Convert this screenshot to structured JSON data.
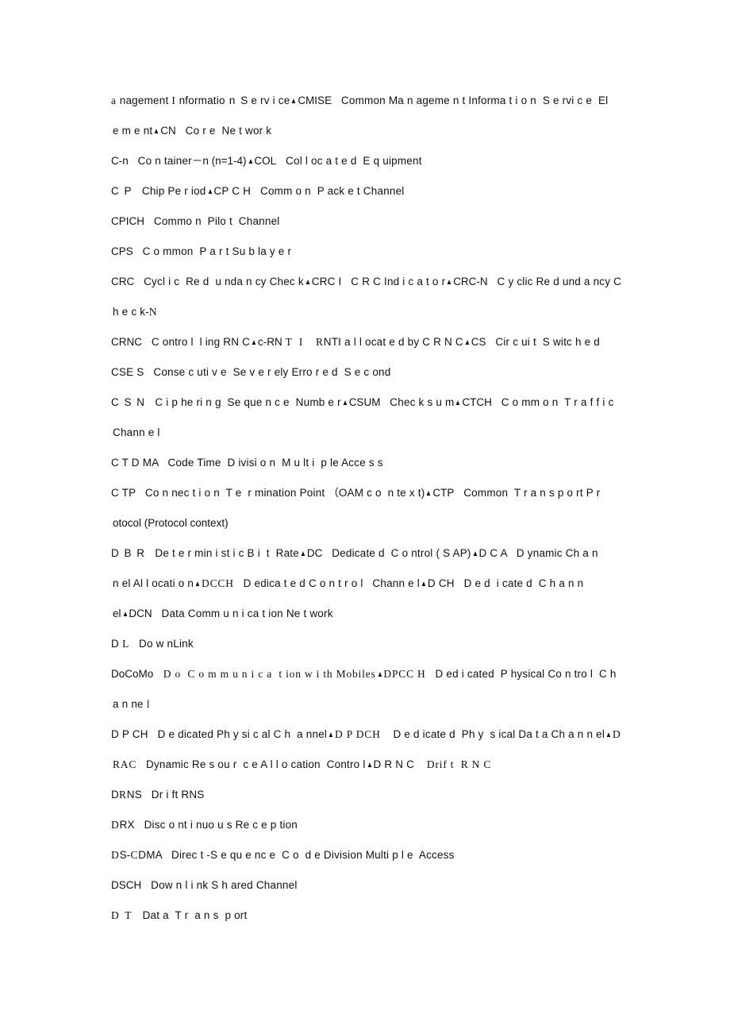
{
  "document": {
    "kind": "abbreviations-glossary",
    "separator_glyph": "▲",
    "separator_name": "triangle-separator",
    "page_background": "#ffffff",
    "text_color": "#111111",
    "lines": [
      {
        "id": "line-1",
        "continuation": false,
        "runs": [
          {
            "text": "a",
            "style": "serif"
          },
          {
            "text": " nagement ",
            "style": "normal"
          },
          {
            "text": "I",
            "style": "serif"
          },
          {
            "text": " nformatio",
            "style": "normal"
          },
          {
            "text": " n ",
            "style": "wide"
          },
          {
            "text": "S e rv i ce",
            "style": "normal"
          },
          {
            "text": "▲",
            "style": "sep"
          },
          {
            "text": "CMISE",
            "style": "tight"
          },
          {
            "text": "   Common Ma n ageme n t Informa t i o n  S e rvi c e  El",
            "style": "normal"
          }
        ],
        "plain": "a nagement I nformatio n S e rv i ce▲CMISE   Common Ma n ageme n t Informa t i o n  S e rvi c e  El"
      },
      {
        "id": "line-2",
        "continuation": true,
        "runs": [
          {
            "text": "e m e nt",
            "style": "normal"
          },
          {
            "text": "▲",
            "style": "sep"
          },
          {
            "text": "CN",
            "style": "tight"
          },
          {
            "text": "   Co r e  Ne t wor k",
            "style": "normal"
          }
        ],
        "plain": "e m e nt▲CN   Co r e  Ne t wor k"
      },
      {
        "id": "line-3",
        "continuation": false,
        "runs": [
          {
            "text": "C-n",
            "style": "tight"
          },
          {
            "text": "   Co n tainer",
            "style": "normal"
          },
          {
            "text": "－",
            "style": "tight"
          },
          {
            "text": "n (n=1-4)",
            "style": "tight"
          },
          {
            "text": "▲",
            "style": "sep"
          },
          {
            "text": "COL",
            "style": "tight"
          },
          {
            "text": "   Col l oc a t e d  E q uipment",
            "style": "normal"
          }
        ],
        "plain": "C-n   Co n tainer－n (n=1-4)▲COL   Col l oc a t e d E q uipment"
      },
      {
        "id": "line-4",
        "continuation": false,
        "runs": [
          {
            "text": "C P",
            "style": "wide"
          },
          {
            "text": "   Chip Pe r iod",
            "style": "normal"
          },
          {
            "text": "▲",
            "style": "sep"
          },
          {
            "text": "CP C H",
            "style": "normal"
          },
          {
            "text": "   Comm o n  P ack e t Channel",
            "style": "normal"
          }
        ],
        "plain": "C P   Chip Pe r iod▲CP C H   Comm o n  P ack e t Channel"
      },
      {
        "id": "line-5",
        "continuation": false,
        "runs": [
          {
            "text": "CPICH",
            "style": "tight"
          },
          {
            "text": "   Commo n  Pilo t  Channel",
            "style": "normal"
          }
        ],
        "plain": "CPICH   Commo n Pilo t  Channel"
      },
      {
        "id": "line-6",
        "continuation": false,
        "runs": [
          {
            "text": "CPS",
            "style": "tight"
          },
          {
            "text": "   C o mmon  P a r t Su b la y e r",
            "style": "normal"
          }
        ],
        "plain": "CPS   C o mmon  P a r t Su b la y e r"
      },
      {
        "id": "line-7",
        "continuation": false,
        "runs": [
          {
            "text": "CRC",
            "style": "tight"
          },
          {
            "text": "   Cycl i c  Re d  u nda n cy Chec k",
            "style": "normal"
          },
          {
            "text": "▲",
            "style": "sep"
          },
          {
            "text": "CRC I",
            "style": "normal"
          },
          {
            "text": "   C R C Ind i c a t o r",
            "style": "normal"
          },
          {
            "text": "▲",
            "style": "sep"
          },
          {
            "text": "CRC-N",
            "style": "tight"
          },
          {
            "text": "   C y clic Re d und a ncy C",
            "style": "normal"
          }
        ],
        "plain": "CRC   Cycl i c  Re d  u nda n cy Chec k▲CRC I   C R C Ind i c a t o r▲CRC-N   C y clic Re d und a ncy C"
      },
      {
        "id": "line-8",
        "continuation": true,
        "runs": [
          {
            "text": "h e c k-",
            "style": "normal"
          },
          {
            "text": "N",
            "style": "serif"
          }
        ],
        "plain": "h e c k-N"
      },
      {
        "id": "line-9",
        "continuation": false,
        "runs": [
          {
            "text": "CRNC",
            "style": "tight"
          },
          {
            "text": "   C ontro l  l ing RN C",
            "style": "normal"
          },
          {
            "text": "▲",
            "style": "sep"
          },
          {
            "text": "c-RN",
            "style": "tight"
          },
          {
            "text": " T  I",
            "style": "serif"
          },
          {
            "text": "    ",
            "style": "normal"
          },
          {
            "text": "R",
            "style": "serif"
          },
          {
            "text": "NTI a l l ocat e d by C R N C",
            "style": "normal"
          },
          {
            "text": "▲",
            "style": "sep"
          },
          {
            "text": "CS",
            "style": "tight"
          },
          {
            "text": "   Cir c ui t  S witc h e d",
            "style": "normal"
          }
        ],
        "plain": "CRNC   C ontro l  l ing RN C▲c-RN T  I    RNTI a l l ocat e d by C R N C▲CS   Cir c ui t  S witc h e d"
      },
      {
        "id": "line-10",
        "continuation": false,
        "runs": [
          {
            "text": "CSE S",
            "style": "normal"
          },
          {
            "text": "   Conse c uti v e  Se v e r ely Erro r e d  S e c ond",
            "style": "normal"
          }
        ],
        "plain": "CSE S   Conse c uti v e  Se v e r ely Erro r e d  S e c ond"
      },
      {
        "id": "line-11",
        "continuation": false,
        "runs": [
          {
            "text": "C S N",
            "style": "wide"
          },
          {
            "text": "   C i p he ri n g  Se que n c e  Numb e r",
            "style": "normal"
          },
          {
            "text": "▲",
            "style": "sep"
          },
          {
            "text": "CSUM",
            "style": "tight"
          },
          {
            "text": "   Chec k s u m",
            "style": "normal"
          },
          {
            "text": "▲",
            "style": "sep"
          },
          {
            "text": "CTCH",
            "style": "tight"
          },
          {
            "text": "   C o mm o n  T r a f f i c",
            "style": "normal"
          }
        ],
        "plain": "C S N   C i p he ri n g  Se que n c e  Numb e r▲CSUM   Chec k s u m▲CTCH   C o mm o n  T r a f f i c"
      },
      {
        "id": "line-12",
        "continuation": true,
        "runs": [
          {
            "text": "Chann e l",
            "style": "normal"
          }
        ],
        "plain": "Chann e l"
      },
      {
        "id": "line-13",
        "continuation": false,
        "runs": [
          {
            "text": "C T D MA",
            "style": "normal"
          },
          {
            "text": "   Code Time  D ivisi o n  M u lt i  p le Acce s s",
            "style": "normal"
          }
        ],
        "plain": "C T D MA   Code Time  D ivisi o n  M u lt i  p le Acce s s"
      },
      {
        "id": "line-14",
        "continuation": false,
        "runs": [
          {
            "text": "C TP",
            "style": "normal"
          },
          {
            "text": "   Co n nec t i o n  T e  r mination Point ",
            "style": "normal"
          },
          {
            "text": "（",
            "style": "tight"
          },
          {
            "text": "OAM c o  n te x t)",
            "style": "normal"
          },
          {
            "text": "▲",
            "style": "sep"
          },
          {
            "text": "CTP",
            "style": "tight"
          },
          {
            "text": "   Common  T r a n s p o rt P r",
            "style": "normal"
          }
        ],
        "plain": "C TP   Co n nec t i o n  T e  r mination Point （OAM c o  n te x t)▲CTP   Common  T r a n s p o rt P r"
      },
      {
        "id": "line-15",
        "continuation": true,
        "runs": [
          {
            "text": "otocol (Protocol context)",
            "style": "tight"
          }
        ],
        "plain": "otocol (Protocol context)"
      },
      {
        "id": "line-16",
        "continuation": false,
        "runs": [
          {
            "text": "D B R",
            "style": "wide"
          },
          {
            "text": "   De t e r min i st i c B i  t  Rate",
            "style": "normal"
          },
          {
            "text": "▲",
            "style": "sep"
          },
          {
            "text": "DC",
            "style": "tight"
          },
          {
            "text": "   Dedicate d  C o ntrol ( S AP)",
            "style": "normal"
          },
          {
            "text": "▲",
            "style": "sep"
          },
          {
            "text": "D C A",
            "style": "normal"
          },
          {
            "text": "   D ynamic Ch a n",
            "style": "normal"
          }
        ],
        "plain": "D B R   De t e r min i st i c B i  t  Rate▲DC   Dedicate d  C o ntrol ( S AP)▲D C A   D ynamic Ch a n"
      },
      {
        "id": "line-17",
        "continuation": true,
        "runs": [
          {
            "text": "n el Al l ocati o n",
            "style": "normal"
          },
          {
            "text": "▲",
            "style": "sep"
          },
          {
            "text": "DCCH",
            "style": "serif"
          },
          {
            "text": "   D edica t e d C o n t r o l   Chann e l",
            "style": "normal"
          },
          {
            "text": "▲",
            "style": "sep"
          },
          {
            "text": "D CH",
            "style": "normal"
          },
          {
            "text": "   D e d  i cate d  C h a n n",
            "style": "normal"
          }
        ],
        "plain": "n el Al l ocati o n▲DCCH   D edica t e d C o n t r o l   Chann e l▲D CH   D e d  i cate d  C h a n n"
      },
      {
        "id": "line-18",
        "continuation": true,
        "runs": [
          {
            "text": "el",
            "style": "tight"
          },
          {
            "text": "▲",
            "style": "sep"
          },
          {
            "text": "DCN",
            "style": "tight"
          },
          {
            "text": "   Data Comm u n i ca t ion Ne t work",
            "style": "normal"
          }
        ],
        "plain": "el▲DCN   Data Comm u n i ca t ion Ne t work"
      },
      {
        "id": "line-19",
        "continuation": false,
        "runs": [
          {
            "text": "D",
            "style": "normal"
          },
          {
            "text": " L",
            "style": "serif"
          },
          {
            "text": "   Do w nLink",
            "style": "normal"
          }
        ],
        "plain": "D L   Do w nLink"
      },
      {
        "id": "line-20",
        "continuation": false,
        "runs": [
          {
            "text": "DoCoMo",
            "style": "tight"
          },
          {
            "text": "   D o  C o m m u n i c a  t ion w i th Mobiles",
            "style": "serif"
          },
          {
            "text": "▲",
            "style": "sep"
          },
          {
            "text": "DPCC H",
            "style": "serif"
          },
          {
            "text": "   D ed i cated  P hysical Co n tro l  C h",
            "style": "normal"
          }
        ],
        "plain": "DoCoMo   D o C o m m u n i c a  t ion w i th Mobiles▲DPCC H   D ed i cated  P hysical Co n tro l  C h"
      },
      {
        "id": "line-21",
        "continuation": true,
        "runs": [
          {
            "text": "a n ne",
            "style": "normal"
          },
          {
            "text": " l",
            "style": "serif"
          }
        ],
        "plain": "a n ne l"
      },
      {
        "id": "line-22",
        "continuation": false,
        "runs": [
          {
            "text": "D P CH",
            "style": "normal"
          },
          {
            "text": "   D e dicated Ph y si c al C h  a nnel",
            "style": "normal"
          },
          {
            "text": "▲",
            "style": "sep"
          },
          {
            "text": "D P DCH",
            "style": "serif"
          },
          {
            "text": "    D e d icate d  Ph y  s ical Da t a Ch a n n el",
            "style": "normal"
          },
          {
            "text": "▲",
            "style": "sep"
          },
          {
            "text": "D",
            "style": "serif"
          }
        ],
        "plain": "D P CH   D e dicated Ph y si c al C h  a nnel▲D P DCH    D e d icate d  Ph y  s ical Da t a Ch a n n el▲D"
      },
      {
        "id": "line-23",
        "continuation": true,
        "runs": [
          {
            "text": "RAC",
            "style": "serif"
          },
          {
            "text": "   Dynamic Re s ou r  c e A l l o cation  Contro l",
            "style": "normal"
          },
          {
            "text": "▲",
            "style": "sep"
          },
          {
            "text": "D R N C",
            "style": "normal"
          },
          {
            "text": "    ",
            "style": "normal"
          },
          {
            "text": "Drif t  R N C",
            "style": "serif"
          }
        ],
        "plain": "RAC   Dynamic Re s ou r  c e A l l o cation  Contro l▲D R N C    Drif t  R N C"
      },
      {
        "id": "line-24",
        "continuation": false,
        "runs": [
          {
            "text": "D",
            "style": "normal"
          },
          {
            "text": "R",
            "style": "serif"
          },
          {
            "text": "NS",
            "style": "normal"
          },
          {
            "text": "   Dr i ft RNS",
            "style": "normal"
          }
        ],
        "plain": "D R NS   Dr i ft RNS"
      },
      {
        "id": "line-25",
        "continuation": false,
        "runs": [
          {
            "text": "D",
            "style": "serif"
          },
          {
            "text": "RX",
            "style": "normal"
          },
          {
            "text": "   Disc o nt i nuo u s Re c e p tion",
            "style": "normal"
          }
        ],
        "plain": "D RX   Disc o nt i nuo u s Re c e p tion"
      },
      {
        "id": "line-26",
        "continuation": false,
        "runs": [
          {
            "text": "D",
            "style": "serif"
          },
          {
            "text": "S-",
            "style": "normal"
          },
          {
            "text": "C",
            "style": "serif"
          },
          {
            "text": "DMA",
            "style": "normal"
          },
          {
            "text": "   Direc t -S e qu e nc e  C o  d e Division Multi p l e  Access",
            "style": "normal"
          }
        ],
        "plain": "D S- C DMA   Direc t -S e qu e nc e  C o  d e Division Multi p l e  Access"
      },
      {
        "id": "line-27",
        "continuation": false,
        "runs": [
          {
            "text": "DSCH",
            "style": "tight"
          },
          {
            "text": "   Dow n l i nk S h ared Channel",
            "style": "normal"
          }
        ],
        "plain": "DSCH   Dow n l i nk S h ared Channel"
      },
      {
        "id": "line-28",
        "continuation": false,
        "runs": [
          {
            "text": "D T",
            "style": "serif-wide"
          },
          {
            "text": "   Dat",
            "style": "normal"
          },
          {
            "text": " a  T r  a n s  p ort",
            "style": "normal"
          }
        ],
        "plain": "D T   Dat a  T r  a n s  p ort"
      }
    ]
  }
}
